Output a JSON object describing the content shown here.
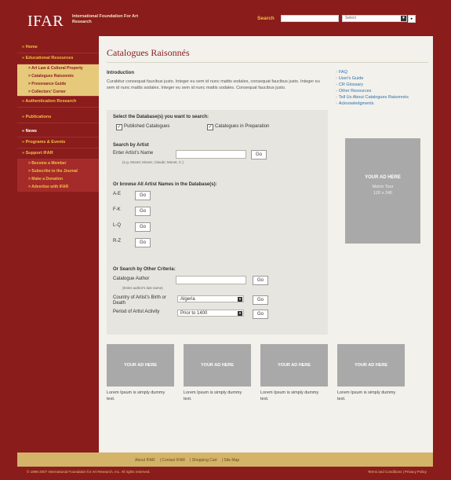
{
  "header": {
    "logo": "IFAR",
    "logo_subtitle": "International Foundation For Art Research",
    "search_label": "Search",
    "search_value": "",
    "select_value": "Select"
  },
  "sidebar": {
    "items": [
      {
        "label": "» Home"
      },
      {
        "label": "» Educational Resources"
      },
      {
        "label": "» Authentication Research"
      },
      {
        "label": "» Publications"
      },
      {
        "label": "» News"
      },
      {
        "label": "» Programs & Events"
      },
      {
        "label": "» Support IFAR"
      }
    ],
    "edu_sub": [
      "> Art Law & Cultural Property",
      "> Catalogues Raisonnés",
      "> Provenance Guide",
      "> Collectors' Corner"
    ],
    "support_sub": [
      "> Become a Member",
      "> Subscribe to the Journal",
      "> Make a Donation",
      "> Advertise with IFAR"
    ]
  },
  "main": {
    "page_title": "Catalogues Raisonnés",
    "intro_title": "Introduction",
    "intro_text": "Curabitur consequat faucibus justo. Integer eu sem id nunc mattis sodales, consequat faucibus justo. Integer eu sem id nunc mattis sodales. Integer eu sem id nunc mattis sodales. Consequat faucibus justo.",
    "panel": {
      "db_heading": "Select the Database(s) you want to search:",
      "published": "Published Catalogues",
      "in_prep": "Catalogues in Preparation",
      "by_artist_heading": "Search by Artist",
      "artist_label": "Enter Artist's Name",
      "artist_hint": "(e.g. Monet; Monet, Claude; Monet, C.)",
      "browse_heading": "Or browse All Artist Names in the Database(s):",
      "ranges": [
        "A-E",
        "F-K",
        "L-Q",
        "R-Z"
      ],
      "go": "Go",
      "other_heading": "Or Search by Other Criteria:",
      "author_label": "Catalogue Author",
      "author_hint": "(Enter author's last name)",
      "country_label": "Country of Artist's Birth or Death",
      "country_value": "Algeria",
      "period_label": "Period of Artist Activity",
      "period_value": "Prior to 1400"
    }
  },
  "right": {
    "links": [
      "FAQ",
      "User's Guide",
      "CR Glossary",
      "Other Resources",
      "Tell Us About Catalogues Raisonnés",
      "Acknowledgments"
    ],
    "ad_title": "YOUR AD HERE",
    "ad_sub1": "Matrix Tour",
    "ad_sub2": "120 x 240"
  },
  "ads": [
    {
      "label": "YOUR AD HERE",
      "caption": "Lorem Ipsum is simply dummy text."
    },
    {
      "label": "YOUR AD HERE",
      "caption": "Lorem Ipsum is simply dummy text."
    },
    {
      "label": "YOUR AD HERE",
      "caption": "Lorem Ipsum is simply dummy text."
    },
    {
      "label": "YOUR AD HERE",
      "caption": "Lorem Ipsum is simply dummy text."
    }
  ],
  "footer": {
    "links": [
      "About IFAR",
      "Contact IFAR",
      "Shopping Cart",
      "Site Map"
    ],
    "copyright": "© 1995-2007 International Foundation for Art Research, Inc. All rights reserved.",
    "terms": "Terms and Conditions  |  Privacy Policy"
  }
}
